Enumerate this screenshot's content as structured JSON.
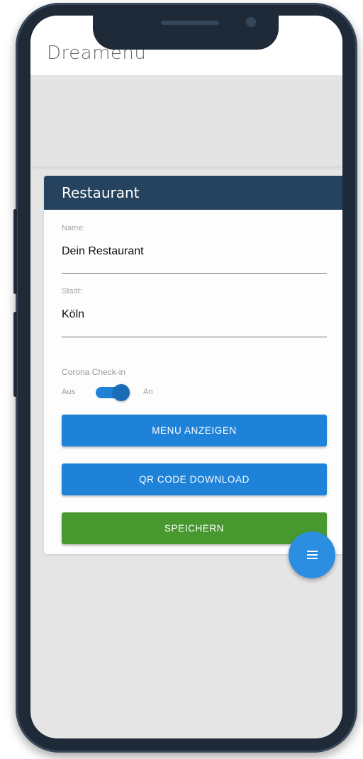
{
  "app": {
    "title": "Dreamenu"
  },
  "card": {
    "title": "Restaurant",
    "fields": [
      {
        "label": "Name:",
        "value": "Dein Restaurant"
      },
      {
        "label": "Stadt:",
        "value": "Köln"
      }
    ],
    "switch": {
      "label": "Corona Check-in",
      "off_label": "Aus",
      "on_label": "An",
      "checked": true
    },
    "buttons": {
      "menu": "MENU ANZEIGEN",
      "qr": "QR CODE DOWNLOAD",
      "save": "SPEICHERN"
    }
  },
  "fab": {
    "icon": "menu-icon"
  },
  "colors": {
    "header": "#25435e",
    "primary": "#1e83d8",
    "success": "#47982f",
    "fab": "#2b8ee0"
  }
}
